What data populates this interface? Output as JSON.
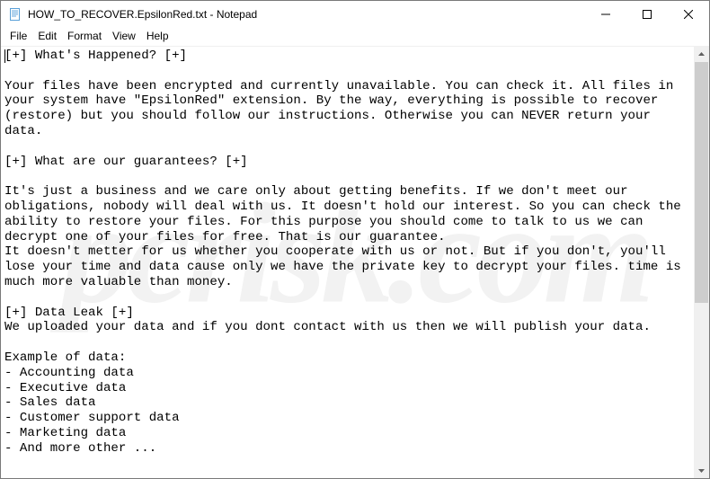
{
  "titlebar": {
    "title": "HOW_TO_RECOVER.EpsilonRed.txt - Notepad"
  },
  "menubar": {
    "items": [
      {
        "label": "File"
      },
      {
        "label": "Edit"
      },
      {
        "label": "Format"
      },
      {
        "label": "View"
      },
      {
        "label": "Help"
      }
    ]
  },
  "editor": {
    "content": "[+] What's Happened? [+]\n\nYour files have been encrypted and currently unavailable. You can check it. All files in your system have \"EpsilonRed\" extension. By the way, everything is possible to recover (restore) but you should follow our instructions. Otherwise you can NEVER return your data.\n\n[+] What are our guarantees? [+]\n\nIt's just a business and we care only about getting benefits. If we don't meet our obligations, nobody will deal with us. It doesn't hold our interest. So you can check the ability to restore your files. For this purpose you should come to talk to us we can decrypt one of your files for free. That is our guarantee.\nIt doesn't metter for us whether you cooperate with us or not. But if you don't, you'll lose your time and data cause only we have the private key to decrypt your files. time is much more valuable than money.\n\n[+] Data Leak [+]\nWe uploaded your data and if you dont contact with us then we will publish your data.\n\nExample of data:\n- Accounting data\n- Executive data\n- Sales data\n- Customer support data\n- Marketing data\n- And more other ..."
  },
  "watermark": {
    "text": "pcrisk.com"
  }
}
